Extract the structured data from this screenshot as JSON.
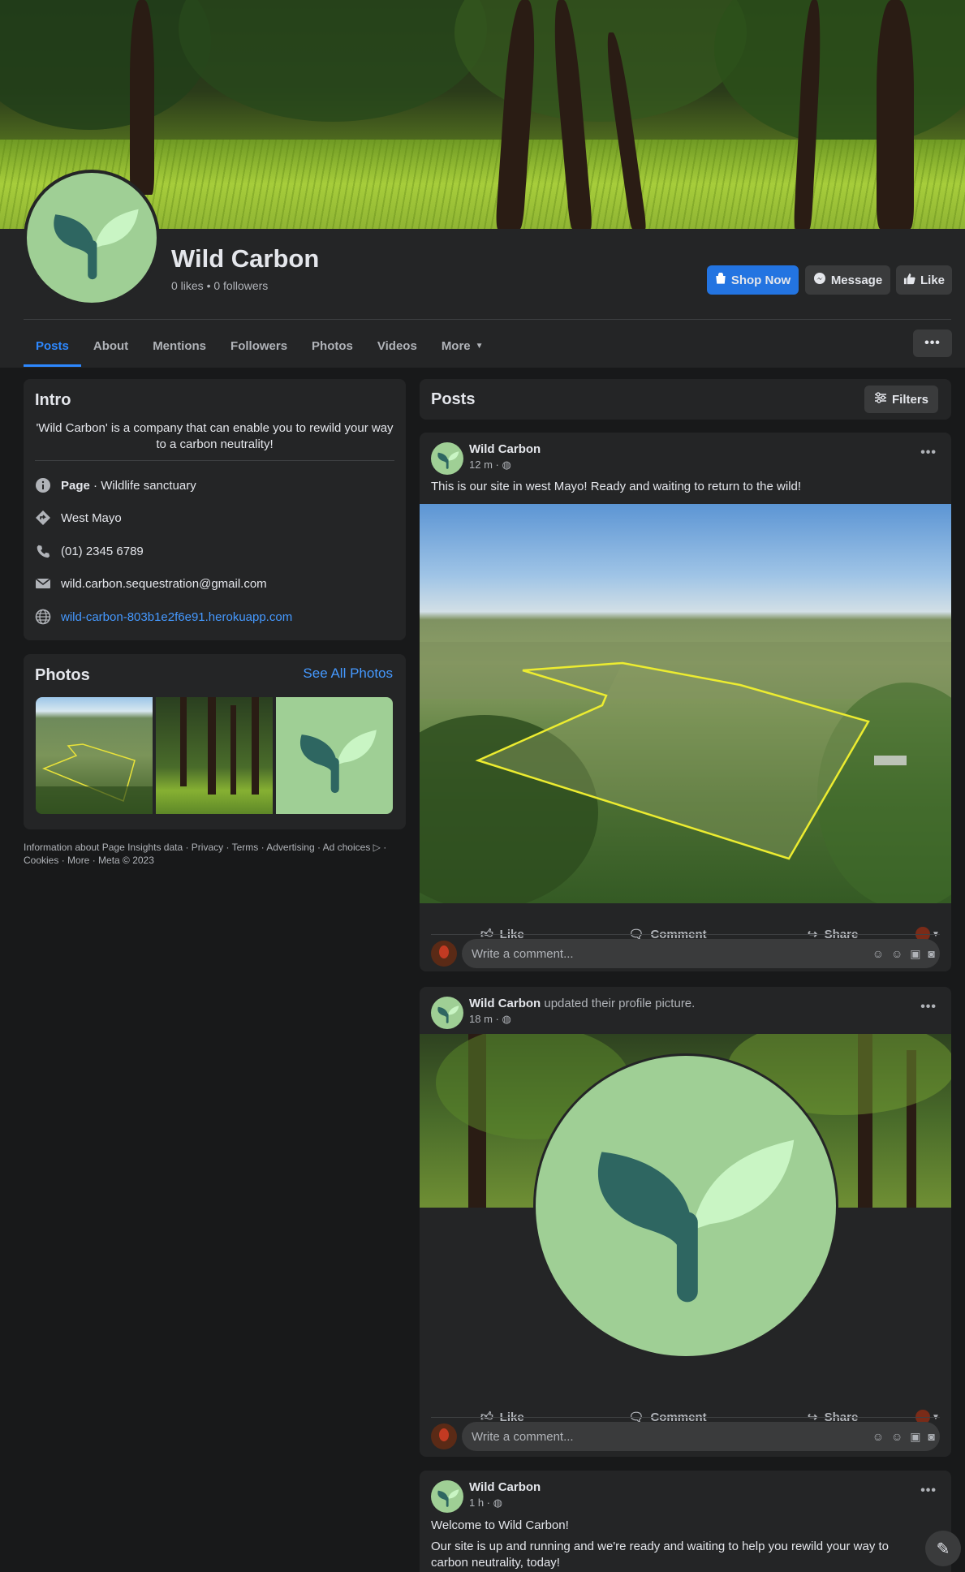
{
  "page": {
    "name": "Wild Carbon",
    "stats": "0 likes • 0 followers"
  },
  "header_buttons": {
    "shop": "Shop Now",
    "message": "Message",
    "like": "Like"
  },
  "tabs": [
    {
      "label": "Posts",
      "active": true
    },
    {
      "label": "About"
    },
    {
      "label": "Mentions"
    },
    {
      "label": "Followers"
    },
    {
      "label": "Photos"
    },
    {
      "label": "Videos"
    },
    {
      "label": "More"
    }
  ],
  "intro": {
    "title": "Intro",
    "bio": "'Wild Carbon' is a company that can enable you to rewild your way to a carbon neutrality!",
    "category_label": "Page",
    "category": " · Wildlife sanctuary",
    "location": "West Mayo",
    "phone": "(01) 2345 6789",
    "email": "wild.carbon.sequestration@gmail.com",
    "website": "wild-carbon-803b1e2f6e91.herokuapp.com"
  },
  "photos": {
    "title": "Photos",
    "see_all": "See All Photos"
  },
  "footer": "Information about Page Insights data · Privacy · Terms · Advertising · Ad choices ▷ · Cookies · More · Meta © 2023",
  "posts_header": {
    "title": "Posts",
    "filters": "Filters"
  },
  "posts": [
    {
      "author": "Wild Carbon",
      "action": "",
      "time": "12 m · ",
      "text": "This is our site in west Mayo! Ready and waiting to return to the wild!"
    },
    {
      "author": "Wild Carbon",
      "action": " updated their profile picture.",
      "time": "18 m · ",
      "text": ""
    },
    {
      "author": "Wild Carbon",
      "action": "",
      "time": "1 h · ",
      "text": "Welcome to Wild Carbon!",
      "text2": "Our site is up and running and we're ready and waiting to help you rewild your way to carbon neutrality, today!"
    }
  ],
  "post_actions": {
    "like": "Like",
    "comment": "Comment",
    "share": "Share"
  },
  "comment_placeholder": "Write a comment...",
  "colors": {
    "background": "#18191a",
    "card": "#242526",
    "accent": "#2374e1",
    "link": "#4599ff",
    "logo_bg": "#9fcf95",
    "logo_dark_leaf": "#2e6661",
    "logo_light_leaf": "#c9f5c4"
  }
}
